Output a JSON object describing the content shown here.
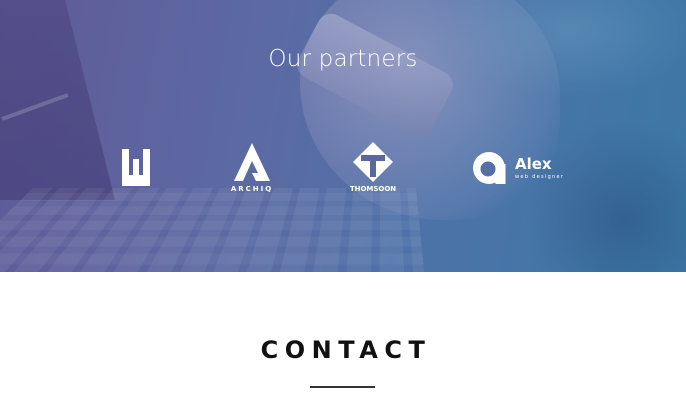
{
  "partners": {
    "title": "Our partners",
    "logos": [
      {
        "icon": "castle-tower-logo-icon",
        "name": ""
      },
      {
        "icon": "archiq-logo-icon",
        "name": "ARCHIQ"
      },
      {
        "icon": "thomsoon-logo-icon",
        "name": "THOMSOON"
      },
      {
        "icon": "alex-logo-icon",
        "name": "Alex",
        "tagline": "web designer"
      }
    ]
  },
  "contact": {
    "title": "CONTACT"
  },
  "colors": {
    "band_gradient_start": "#5f5a97",
    "band_gradient_end": "#3b78a6",
    "heading_text": "#111111",
    "logo_white": "#ffffff"
  }
}
